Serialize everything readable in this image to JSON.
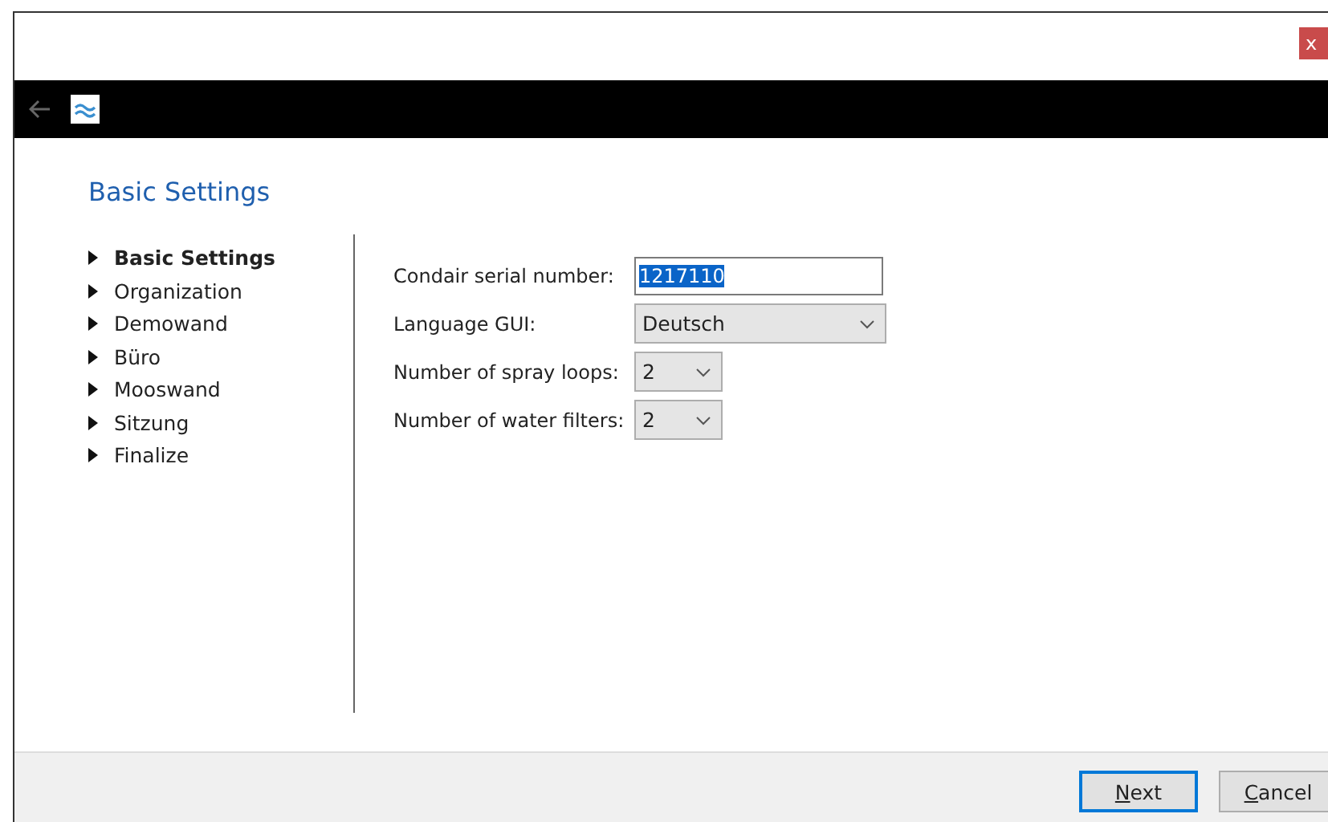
{
  "window": {
    "close": "x"
  },
  "heading": "Basic Settings",
  "nav": [
    {
      "label": "Basic Settings",
      "selected": true
    },
    {
      "label": "Organization",
      "selected": false
    },
    {
      "label": "Demowand",
      "selected": false
    },
    {
      "label": "Büro",
      "selected": false
    },
    {
      "label": "Mooswand",
      "selected": false
    },
    {
      "label": "Sitzung",
      "selected": false
    },
    {
      "label": "Finalize",
      "selected": false
    }
  ],
  "form": [
    {
      "kind": "text",
      "label": "Condair serial number:",
      "value": "1217110",
      "text_selected": true
    },
    {
      "kind": "select",
      "label": "Language GUI:",
      "value": "Deutsch",
      "wide": true
    },
    {
      "kind": "select",
      "label": "Number of spray loops:",
      "value": "2",
      "wide": false
    },
    {
      "kind": "select",
      "label": "Number of water filters:",
      "value": "2",
      "wide": false
    }
  ],
  "buttons": [
    {
      "accel": "N",
      "rest": "ext",
      "default": true
    },
    {
      "accel": "C",
      "rest": "ancel",
      "default": false
    }
  ]
}
